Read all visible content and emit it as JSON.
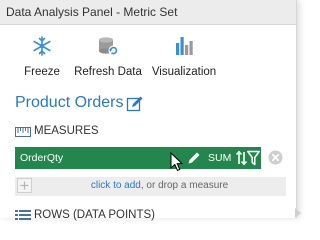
{
  "window": {
    "title": "Data Analysis Panel - Metric Set"
  },
  "toolbar": {
    "freeze_label": "Freeze",
    "refresh_label": "Refresh Data",
    "visualization_label": "Visualization"
  },
  "section": {
    "title": "Product Orders"
  },
  "measures": {
    "header": "MEASURES",
    "field": {
      "name": "OrderQty",
      "aggregation": "SUM"
    },
    "drop_zone": {
      "link": "click to add",
      "rest": ", or drop a measure"
    }
  },
  "rows": {
    "header": "ROWS (DATA POINTS)"
  },
  "colors": {
    "accent": "#2b79c2",
    "field_green": "#23874d"
  },
  "icons": {
    "freeze": "snowflake-icon",
    "refresh": "refresh-data-icon",
    "visualization": "bar-chart-icon",
    "edit": "edit-pencil-icon",
    "measures": "ruler-icon",
    "rows": "rows-icon"
  }
}
